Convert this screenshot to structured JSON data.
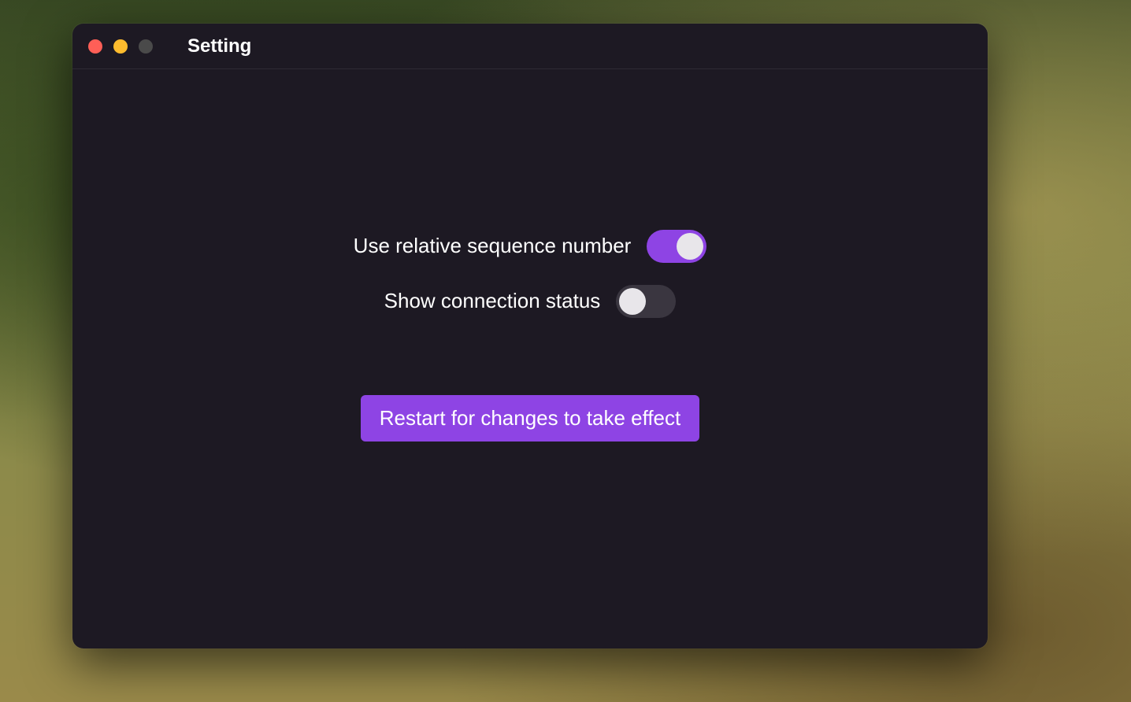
{
  "window": {
    "title": "Setting"
  },
  "settings": {
    "relative_sequence": {
      "label": "Use relative sequence number",
      "enabled": true
    },
    "connection_status": {
      "label": "Show connection status",
      "enabled": false
    }
  },
  "actions": {
    "restart_label": "Restart for changes to take effect"
  },
  "colors": {
    "accent": "#8e44e4",
    "window_bg": "#1d1923",
    "toggle_off": "#3a3640"
  }
}
